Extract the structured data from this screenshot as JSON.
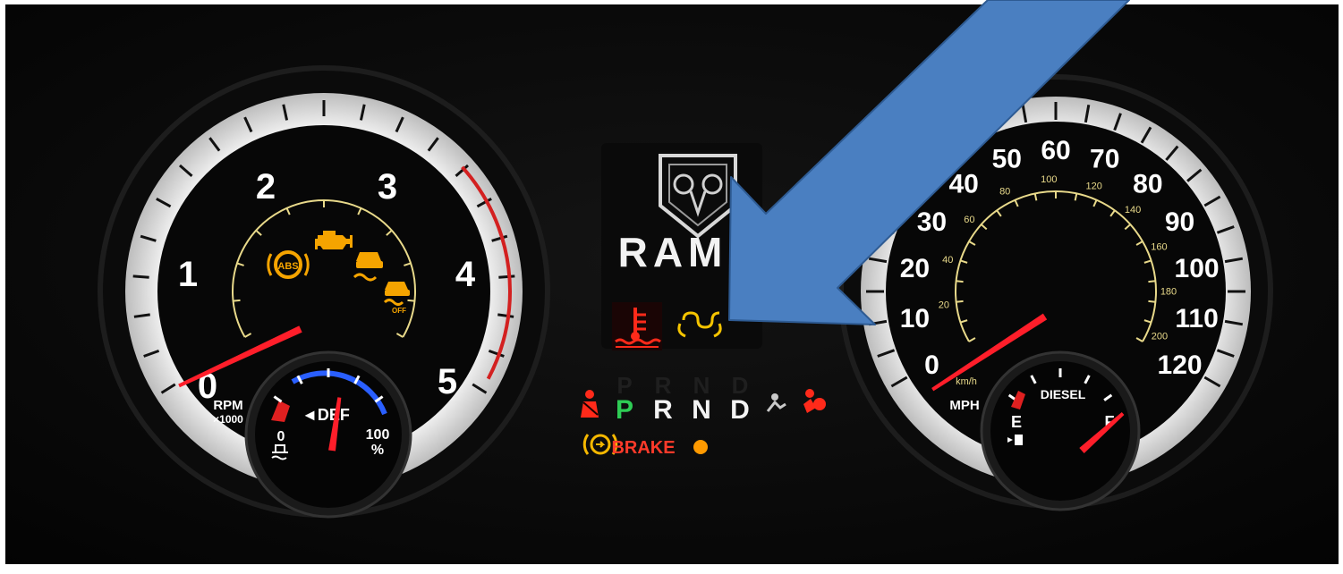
{
  "tachometer": {
    "numbers": [
      "0",
      "1",
      "2",
      "3",
      "4",
      "5"
    ],
    "unit_label": "RPM",
    "unit_sub": "×1000",
    "needle_value": 0.6
  },
  "def_gauge": {
    "label": "◄DEF",
    "min_label": "0",
    "max_label": "100",
    "max_unit": "%",
    "level_percent": 45
  },
  "speedometer": {
    "mph_numbers": [
      "0",
      "10",
      "20",
      "30",
      "40",
      "50",
      "60",
      "70",
      "80",
      "90",
      "100",
      "110",
      "120"
    ],
    "kmh_numbers": [
      "20",
      "40",
      "60",
      "80",
      "100",
      "120",
      "140",
      "160",
      "180",
      "200"
    ],
    "unit_label": "MPH",
    "kmh_label": "km/h",
    "needle_value": 3
  },
  "fuel_gauge": {
    "label": "DIESEL",
    "empty_label": "E",
    "full_label": "F",
    "level_fraction": 0.8
  },
  "center": {
    "brand": "RAM",
    "gear_positions": [
      "P",
      "R",
      "N",
      "D"
    ],
    "selected_gear": "P",
    "brake_label": "BRAKE"
  },
  "warning_lights": [
    {
      "name": "abs-warning-icon",
      "color": "#f5a400",
      "text": "ABS"
    },
    {
      "name": "check-engine-icon",
      "color": "#f5a400"
    },
    {
      "name": "traction-control-icon",
      "color": "#f5a400"
    },
    {
      "name": "traction-control-off-icon",
      "color": "#f5a400",
      "text": "OFF"
    },
    {
      "name": "coolant-temp-icon",
      "color": "#ff2a1a"
    },
    {
      "name": "glow-plug-icon",
      "color": "#f5c400"
    },
    {
      "name": "seatbelt-icon",
      "color": "#ff2a1a"
    },
    {
      "name": "airbag-icon",
      "color": "#ff2a1a"
    },
    {
      "name": "parking-brake-icon",
      "color": "#f5b800"
    },
    {
      "name": "amber-indicator-dot",
      "color": "#ff9a00"
    }
  ],
  "colors": {
    "background": "#050505",
    "dial_ring": "#e9e9e9",
    "needle": "#ff1e2a",
    "arrow": "#4a7fc1",
    "arrow_outline": "#2e5b93",
    "gauge_yellow": "#e8d98a",
    "def_blue": "#2a5fff"
  }
}
